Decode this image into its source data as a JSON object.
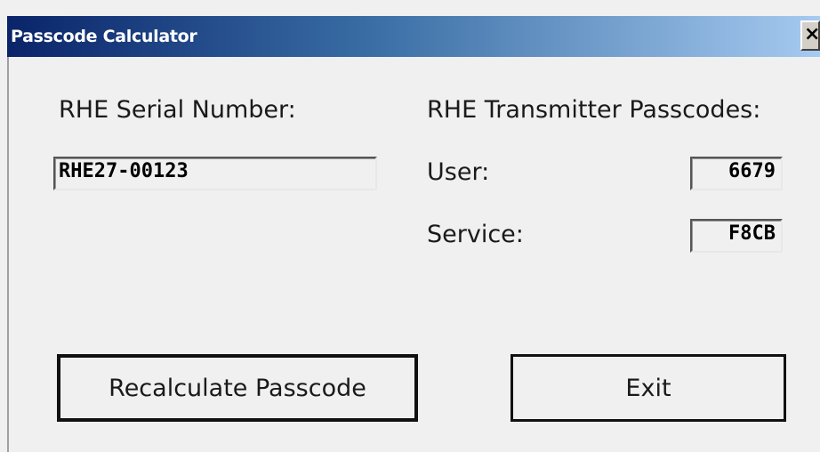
{
  "window": {
    "title": "Passcode Calculator",
    "close_label": "×"
  },
  "serial": {
    "label": "RHE Serial Number:",
    "value": "RHE27-00123"
  },
  "passcodes": {
    "header": "RHE Transmitter Passcodes:",
    "user_label": "User:",
    "user_value": "6679",
    "service_label": "Service:",
    "service_value": "F8CB"
  },
  "buttons": {
    "recalculate_label": "Recalculate Passcode",
    "exit_label": "Exit"
  },
  "colors": {
    "titlebar_start": "#0a246a",
    "titlebar_end": "#a6caf0",
    "dialog_bg": "#f0f0f0"
  }
}
